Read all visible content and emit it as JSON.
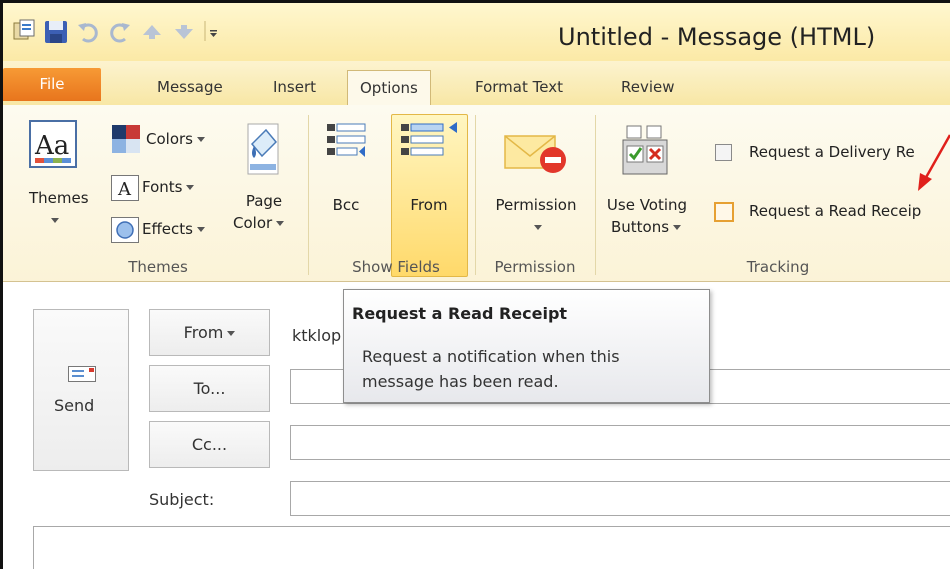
{
  "window": {
    "title": "Untitled - Message (HTML)"
  },
  "quick_access": [
    "app-icon",
    "save-icon",
    "undo-icon",
    "redo-icon",
    "up-arrow-icon",
    "down-arrow-icon",
    "customize-qat-icon"
  ],
  "tabs": [
    {
      "label": "File"
    },
    {
      "label": "Message"
    },
    {
      "label": "Insert"
    },
    {
      "label": "Options"
    },
    {
      "label": "Format Text"
    },
    {
      "label": "Review"
    }
  ],
  "ribbon": {
    "themes_group": {
      "label": "Themes",
      "themes_button": "Themes",
      "colors": "Colors",
      "fonts": "Fonts",
      "effects": "Effects",
      "page_color_line1": "Page",
      "page_color_line2": "Color"
    },
    "show_fields_group": {
      "label": "Show Fields",
      "bcc": "Bcc",
      "from": "From"
    },
    "permission_group": {
      "label": "Permission",
      "permission": "Permission"
    },
    "tracking_group": {
      "label": "Tracking",
      "voting_line1": "Use Voting",
      "voting_line2": "Buttons",
      "delivery_receipt": "Request a Delivery Re",
      "read_receipt": "Request a Read Receip"
    }
  },
  "compose": {
    "send": "Send",
    "from_button": "From",
    "from_value": "ktklop",
    "to_button": "To...",
    "cc_button": "Cc...",
    "subject_label": "Subject:"
  },
  "tooltip": {
    "title": "Request a Read Receipt",
    "body": "Request a notification when this message has been read."
  },
  "colors": {
    "file_tab": "#e8751d",
    "ribbon_bg": "#fbf3d7",
    "highlight": "#ffd96a",
    "annotation_arrow": "#e0201b"
  }
}
